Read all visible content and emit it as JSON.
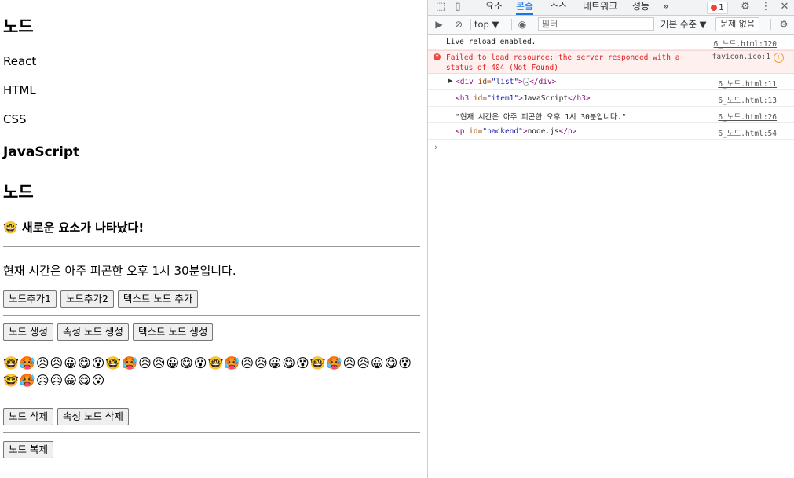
{
  "page": {
    "heading1": "노드",
    "list_items": [
      "React",
      "HTML",
      "CSS"
    ],
    "item1": "JavaScript",
    "heading2": "노드",
    "new_element": "🤓 새로운 요소가 나타났다!",
    "time_text": "현재 시간은 아주 피곤한 오후 1시 30분입니다.",
    "buttons_row1": [
      "노드추가1",
      "노드추가2",
      "텍스트 노드 추가"
    ],
    "buttons_row2": [
      "노드 생성",
      "속성 노드 생성",
      "텍스트 노드 생성"
    ],
    "emojis": "🤓🥵😥😥😀😋😵🤓🥵😥😥😀😋😵🤓🥵😥😥😀😋😵🤓🥵😥😥😀😋😵🤓🥵😥😥😀😋😵",
    "buttons_row3": [
      "노드 삭제",
      "속성 노드 삭제"
    ],
    "buttons_row4": [
      "노드 복제"
    ]
  },
  "devtools": {
    "tabs": [
      "요소",
      "콘솔",
      "소스",
      "네트워크",
      "성능"
    ],
    "active_tab": "콘솔",
    "more_tabs": "»",
    "error_count": "1",
    "context": "top ▼",
    "filter_placeholder": "필터",
    "log_level": "기본 수준 ▼",
    "issues": "문제 없음",
    "messages": [
      {
        "text": "Live reload enabled.",
        "source": "6_노드.html:120"
      },
      {
        "text": "Failed to load resource: the server responded with a\nstatus of 404 (Not Found)",
        "source": "favicon.ico:1"
      },
      {
        "tag_open": "<div",
        "attr": " id=",
        "value": "\"list\"",
        "tag_mid": ">",
        "ellipsis": "…",
        "tag_close": "</div>",
        "source": "6_노드.html:11"
      },
      {
        "tag_open": "<h3",
        "attr": " id=",
        "value": "\"item1\"",
        "tag_mid": ">",
        "inner": "JavaScript",
        "tag_close": "</h3>",
        "source": "6_노드.html:13"
      },
      {
        "text": "\"현재 시간은 아주 피곤한 오후 1시 30분입니다.\"",
        "source": "6_노드.html:26"
      },
      {
        "tag_open": "<p",
        "attr": " id=",
        "value": "\"backend\"",
        "tag_mid": ">",
        "inner": "node.js",
        "tag_close": "</p>",
        "source": "6_노드.html:54"
      }
    ],
    "prompt": "›"
  },
  "colors": {
    "accent": "#1a73e8",
    "error": "#e8453c",
    "error_bg": "#fff0f0"
  }
}
